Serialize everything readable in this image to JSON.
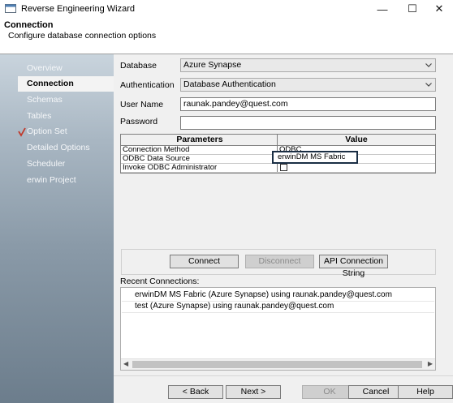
{
  "window": {
    "title": "Reverse Engineering Wizard",
    "minimize": "—",
    "maximize": "☐",
    "close": "✕"
  },
  "header": {
    "title": "Connection",
    "subtitle": "Configure database connection options"
  },
  "sidebar": {
    "items": [
      {
        "label": "Overview"
      },
      {
        "label": "Connection"
      },
      {
        "label": "Schemas"
      },
      {
        "label": "Tables"
      },
      {
        "label": "Option Set"
      },
      {
        "label": "Detailed Options"
      },
      {
        "label": "Scheduler"
      },
      {
        "label": "erwin Project"
      }
    ]
  },
  "form": {
    "database_label": "Database",
    "database_value": "Azure Synapse",
    "auth_label": "Authentication",
    "auth_value": "Database Authentication",
    "user_label": "User Name",
    "user_value": "raunak.pandey@quest.com",
    "password_label": "Password",
    "password_value": ""
  },
  "grid": {
    "headers": [
      "Parameters",
      "Value"
    ],
    "rows": [
      {
        "param": "Connection Method",
        "value": "ODBC"
      },
      {
        "param": "ODBC Data Source",
        "value": "erwinDM MS Fabric"
      },
      {
        "param": "Invoke ODBC Administrator",
        "value": ""
      }
    ]
  },
  "buttons": {
    "connect": "Connect",
    "disconnect": "Disconnect",
    "api": "API Connection String"
  },
  "recent": {
    "label": "Recent Connections:",
    "items": [
      "erwinDM MS Fabric (Azure Synapse) using raunak.pandey@quest.com",
      "test (Azure Synapse) using raunak.pandey@quest.com"
    ]
  },
  "footer": {
    "back": "< Back",
    "next": "Next >",
    "ok": "OK",
    "cancel": "Cancel",
    "help": "Help"
  },
  "colors": {
    "accent_check": "#c0392b",
    "sidebar_top": "#c9d4dd",
    "sidebar_bottom": "#6c7d8c"
  }
}
